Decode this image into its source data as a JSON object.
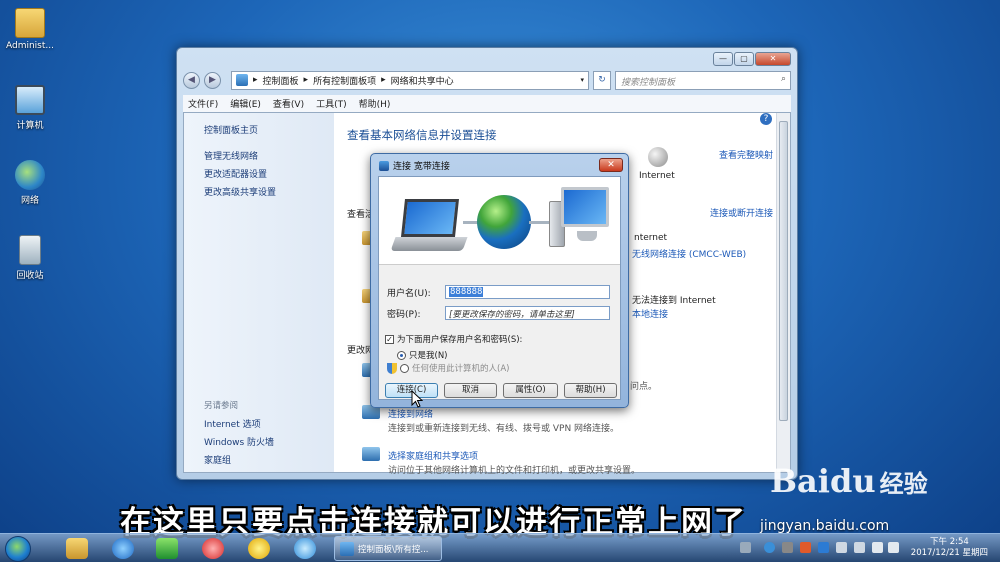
{
  "desktop": {
    "icons": [
      {
        "label": "Administ..."
      },
      {
        "label": "计算机"
      },
      {
        "label": "网络"
      },
      {
        "label": "回收站"
      }
    ]
  },
  "explorer": {
    "nav": {
      "back": "◀",
      "forward": "▶"
    },
    "breadcrumb": {
      "c1": "控制面板",
      "c2": "所有控制面板项",
      "c3": "网络和共享中心",
      "sep": "▸",
      "dropdown": "▾"
    },
    "refresh": "↻",
    "search_placeholder": "搜索控制面板",
    "menu": [
      "文件(F)",
      "编辑(E)",
      "查看(V)",
      "工具(T)",
      "帮助(H)"
    ],
    "controls": {
      "min": "—",
      "max": "▢",
      "close": "✕"
    },
    "left_links": [
      "控制面板主页",
      "管理无线网络",
      "更改适配器设置",
      "更改高级共享设置"
    ],
    "see_also": {
      "heading": "另请参阅",
      "links": [
        "Internet 选项",
        "Windows 防火墙",
        "家庭组"
      ]
    },
    "content": {
      "help": "?",
      "title": "查看基本网络信息并设置连接",
      "view_full_map": "查看完整映射",
      "internet_label": "Internet",
      "section_active_partial": "查看活",
      "connect_disconnect": "连接或断开连接",
      "conn1_access_partial": "nternet",
      "conn1_link": "无线网络连接 (CMCC-WEB)",
      "conn2_access": "无法连接到 Internet",
      "conn2_link": "本地连接",
      "change_partial": "更改网",
      "item_desc_partial": "问点。",
      "item2_title": "连接到网络",
      "item2_desc": "连接到或重新连接到无线、有线、拨号或 VPN 网络连接。",
      "item3_title": "选择家庭组和共享选项",
      "item3_desc": "访问位于其他网络计算机上的文件和打印机，或更改共享设置。"
    }
  },
  "dialog": {
    "title": "连接 宽带连接",
    "close": "✕",
    "username_label": "用户名(U):",
    "username_value": "888888",
    "password_label": "密码(P):",
    "password_placeholder": "[要更改保存的密码，请单击这里]",
    "save_checkbox": "为下面用户保存用户名和密码(S):",
    "checkmark": "✓",
    "radio_me": "只是我(N)",
    "radio_anyone": "任何使用此计算机的人(A)",
    "buttons": {
      "connect": "连接(C)",
      "cancel": "取消",
      "properties": "属性(O)",
      "help": "帮助(H)"
    }
  },
  "subtitle": "在这里只要点击连接就可以进行正常上网了",
  "watermark": {
    "brand": "Baidu",
    "suffix": "经验",
    "url": "jingyan.baidu.com"
  },
  "taskbar": {
    "task_label": "控制面板\\所有控...",
    "clock_ampm": "下午 2:54",
    "clock_date": "2017/12/21 星期四"
  }
}
